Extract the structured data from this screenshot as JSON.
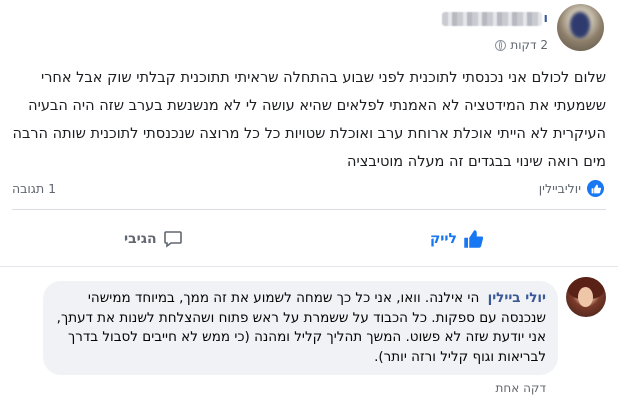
{
  "post": {
    "author_suffix": "ו",
    "timestamp": "2 דקות",
    "text": "שלום לכולם אני נכנסתי לתוכנית לפני שבוע בהתחלה שראיתי תתוכנית קבלתי שוק אבל אחרי ששמעתי את המידטציה לא האמנתי לפלאים שהיא עושה לי לא מנשנשת בערב שזה היה הבעיה העיקרית לא הייתי אוכלת ארוחת ערב ואוכלת שטויות כל כל מרוצה שנכנסתי לתוכנית שותה הרבה מים רואה שינוי בבגדים זה מעלה מוטיבציה",
    "reactor_name": "יוליביילין",
    "comment_count_label": "1 תגובה",
    "like_label": "לייק",
    "comment_label": "הגיבי"
  },
  "comment": {
    "author": "יולי ביילין",
    "text": "הי אילנה. וואו, אני כל כך שמחה לשמוע את זה ממך, במיוחד ממישהי שנכנסה עם ספקות. כל הכבוד על ששמרת על ראש פתוח ושהצלחת לשנות את דעתך, אני יודעת שזה לא פשוט. המשך תהליך קליל ומהנה (כי ממש לא חייבים לסבול בדרך לבריאות וגוף קליל ורזה יותר).",
    "time": "דקה אחת"
  },
  "colors": {
    "accent": "#1877f2",
    "name_link": "#385898",
    "muted_text": "#616770",
    "bubble_bg": "#f0f2f5"
  },
  "icons": [
    "globe-icon",
    "like-reaction-icon",
    "thumbs-up-icon",
    "comment-icon"
  ]
}
